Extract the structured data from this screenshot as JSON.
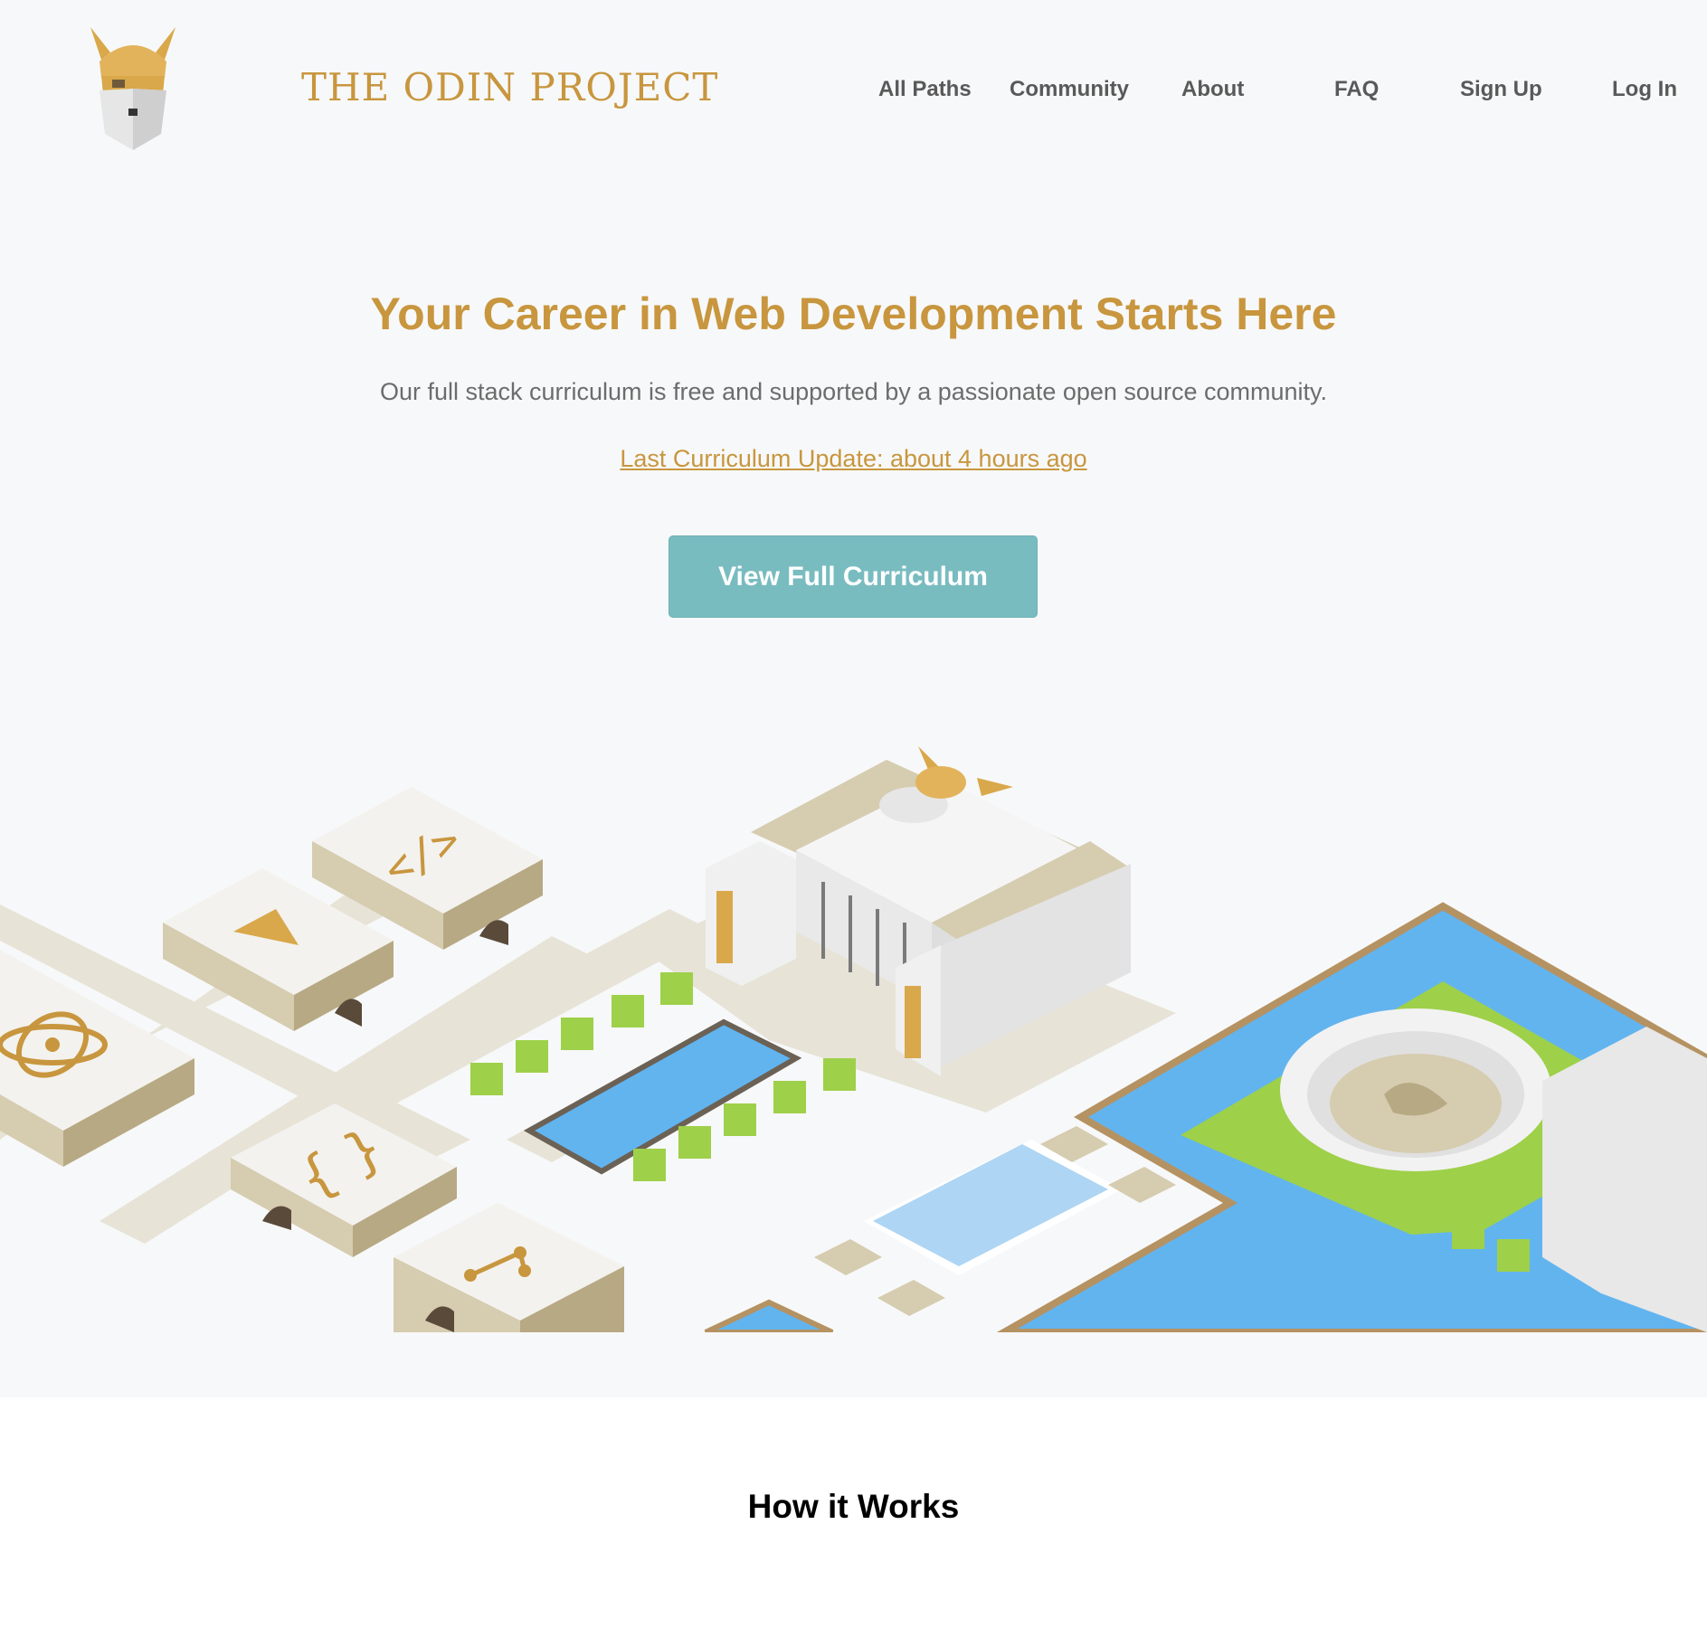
{
  "header": {
    "logo_icon": "odin-viking-head",
    "brand": "THE ODIN PROJECT",
    "nav": {
      "all_paths": "All Paths",
      "community": "Community",
      "about": "About",
      "faq": "FAQ",
      "sign_up": "Sign Up",
      "log_in": "Log In"
    }
  },
  "hero": {
    "title": "Your Career in Web Development Starts Here",
    "subtitle": "Our full stack curriculum is free and supported by a passionate open source community.",
    "update_link": "Last Curriculum Update: about 4 hours ago",
    "cta": "View Full Curriculum",
    "illustration": "isometric-odin-campus"
  },
  "how_it_works": {
    "title": "How it Works"
  },
  "colors": {
    "brand_gold": "#c8963e",
    "cta_teal": "#79bcc0",
    "hero_bg": "#f7f8f9",
    "water": "#62b4ef",
    "grass": "#9ed04a"
  }
}
